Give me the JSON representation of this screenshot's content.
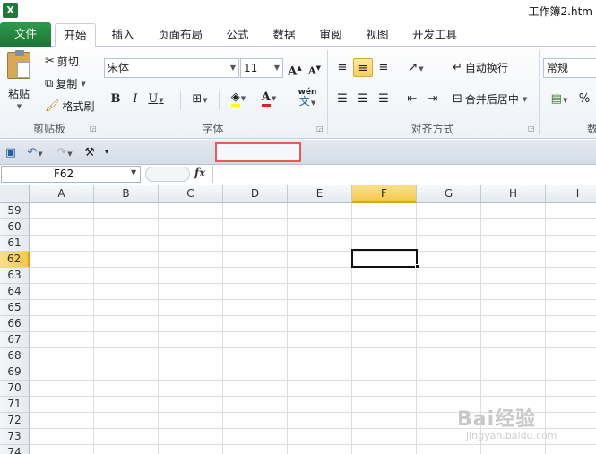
{
  "window": {
    "title": "工作簿2.htm",
    "app_icon": "X"
  },
  "tabs": [
    {
      "label": "文件"
    },
    {
      "label": "开始"
    },
    {
      "label": "插入"
    },
    {
      "label": "页面布局"
    },
    {
      "label": "公式"
    },
    {
      "label": "数据"
    },
    {
      "label": "审阅"
    },
    {
      "label": "视图"
    },
    {
      "label": "开发工具"
    }
  ],
  "ribbon": {
    "clipboard": {
      "paste": "粘贴",
      "cut": "剪切",
      "copy": "复制",
      "format_painter": "格式刷",
      "label": "剪贴板"
    },
    "font": {
      "name": "宋体",
      "size": "11",
      "bold": "B",
      "italic": "I",
      "underline": "U",
      "label": "字体",
      "grow": "A",
      "shrink": "A",
      "phonetic": "wén",
      "phonetic2": "文"
    },
    "alignment": {
      "wrap": "自动换行",
      "merge": "合并后居中",
      "label": "对齐方式"
    },
    "number": {
      "format": "常规",
      "percent": "%",
      "label": "数"
    }
  },
  "formula_bar": {
    "name_box": "F62",
    "fx": "fx",
    "value": ""
  },
  "grid": {
    "columns": [
      "A",
      "B",
      "C",
      "D",
      "E",
      "F",
      "G",
      "H",
      "I"
    ],
    "selected_column": "F",
    "rows": [
      "59",
      "60",
      "61",
      "62",
      "63",
      "64",
      "65",
      "66",
      "67",
      "68",
      "69",
      "70",
      "71",
      "72",
      "73",
      "74"
    ],
    "selected_row": "62"
  },
  "watermark": {
    "brand": "Bai经验",
    "url": "jingyan.baidu.com"
  },
  "colors": {
    "file_tab": "#1f7a3a",
    "highlight": "#f5c84c",
    "red_box": "#e85a52",
    "font_color": "#e02020",
    "fill_color": "#ffff00"
  }
}
